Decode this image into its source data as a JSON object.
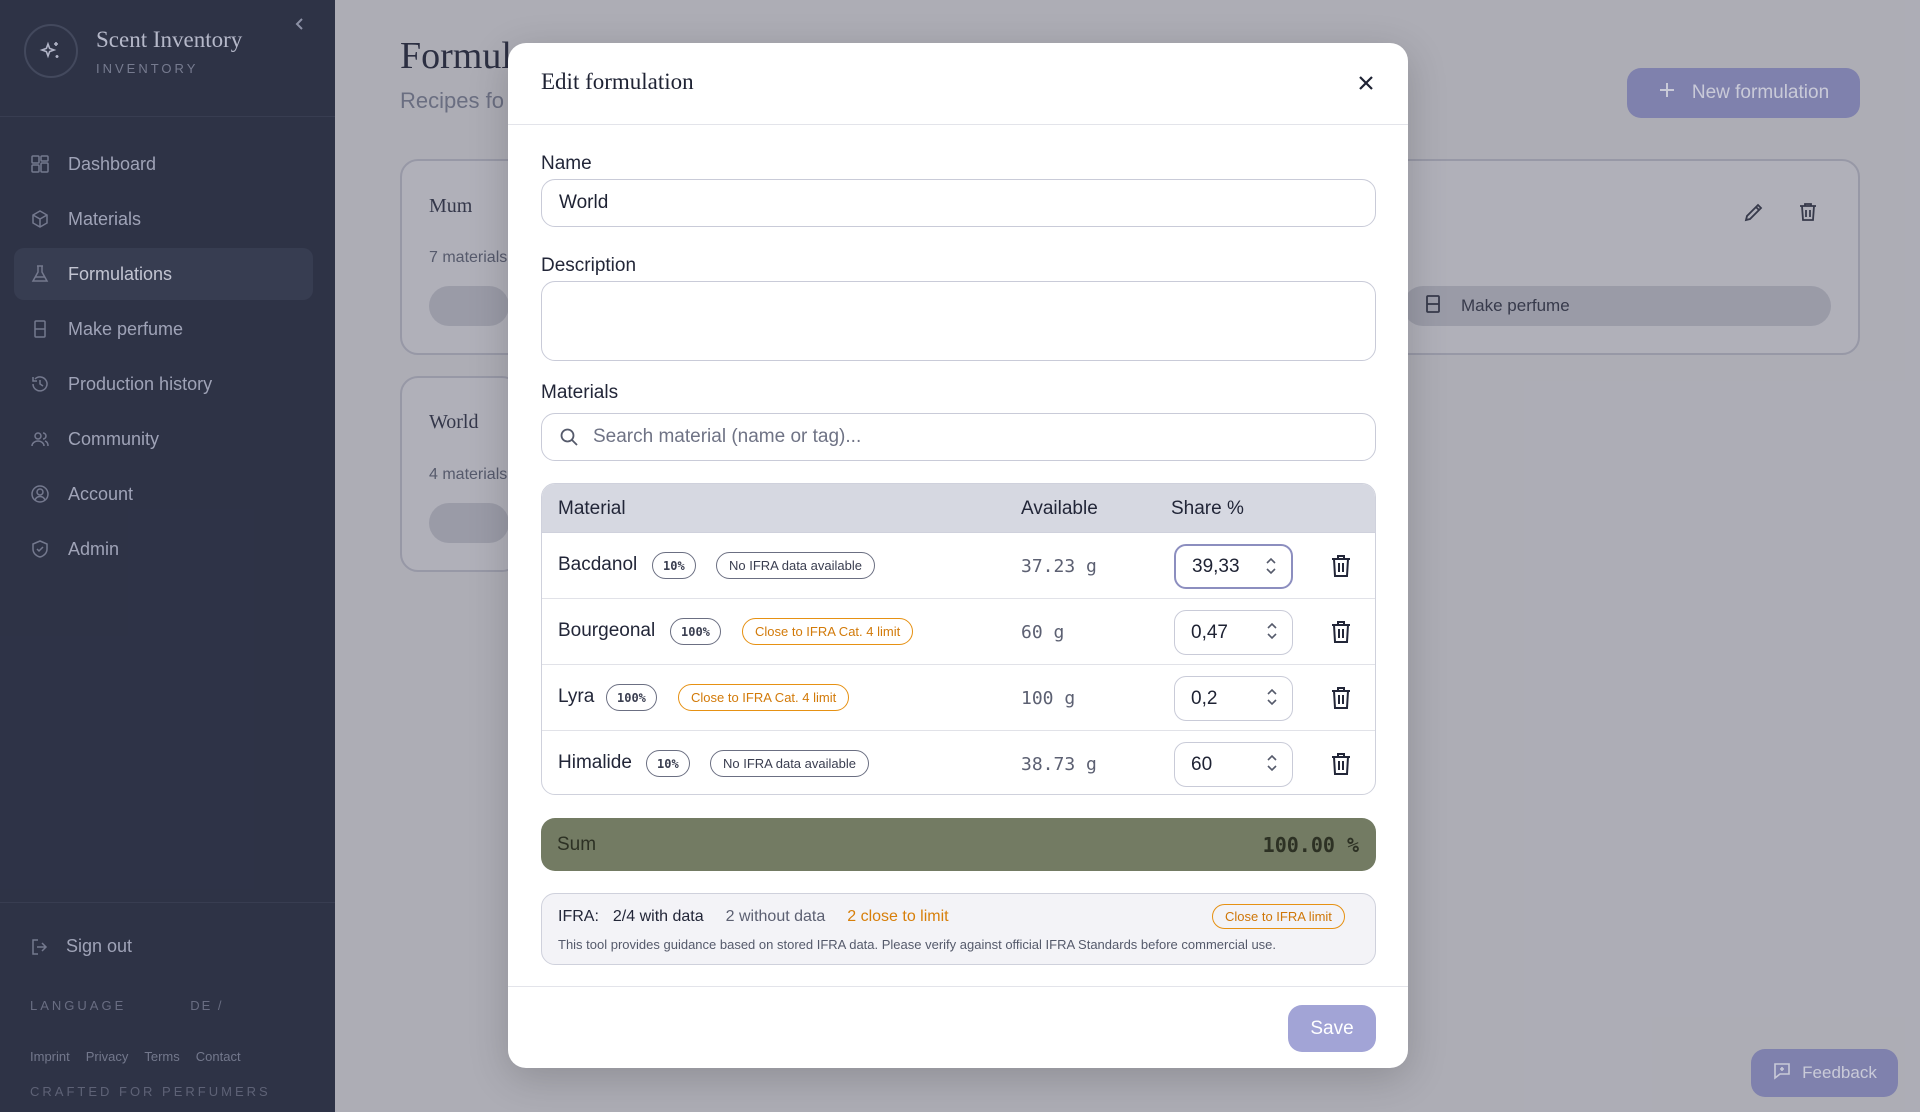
{
  "brand": {
    "title": "Scent Inventory",
    "subtitle": "INVENTORY",
    "logo_icon": "sparkle-icon"
  },
  "sidebar": {
    "items": [
      {
        "label": "Dashboard",
        "icon": "grid-icon"
      },
      {
        "label": "Materials",
        "icon": "box-icon"
      },
      {
        "label": "Formulations",
        "icon": "flask-icon",
        "active": true
      },
      {
        "label": "Make perfume",
        "icon": "bottle-icon"
      },
      {
        "label": "Production history",
        "icon": "history-icon"
      },
      {
        "label": "Community",
        "icon": "users-icon"
      },
      {
        "label": "Account",
        "icon": "user-circle-icon"
      },
      {
        "label": "Admin",
        "icon": "shield-icon"
      }
    ],
    "signout": "Sign out",
    "language_label": "LANGUAGE",
    "language_options": "DE  /",
    "footer_links": [
      "Imprint",
      "Privacy",
      "Terms",
      "Contact"
    ],
    "crafted": "CRAFTED FOR PERFUMERS"
  },
  "main": {
    "title": "Formul",
    "subtitle": "Recipes fo",
    "new_button": "New formulation",
    "cards": [
      {
        "title": "Mum",
        "meta": "7 materials"
      },
      {
        "title": "World",
        "meta": "4 materials"
      }
    ],
    "make_perfume": "Make perfume"
  },
  "modal": {
    "title": "Edit formulation",
    "name_label": "Name",
    "name_value": "World",
    "description_label": "Description",
    "description_value": "",
    "materials_label": "Materials",
    "search_placeholder": "Search material (name or tag)...",
    "table": {
      "headers": [
        "Material",
        "Available",
        "Share %"
      ],
      "rows": [
        {
          "name": "Bacdanol",
          "pct": "10%",
          "status": "No IFRA data available",
          "status_type": "neutral",
          "available": "37.23 g",
          "share": "39,33"
        },
        {
          "name": "Bourgeonal",
          "pct": "100%",
          "status": "Close to IFRA Cat. 4 limit",
          "status_type": "warn",
          "available": "60 g",
          "share": "0,47"
        },
        {
          "name": "Lyra",
          "pct": "100%",
          "status": "Close to IFRA Cat. 4 limit",
          "status_type": "warn",
          "available": "100 g",
          "share": "0,2"
        },
        {
          "name": "Himalide",
          "pct": "10%",
          "status": "No IFRA data available",
          "status_type": "neutral",
          "available": "38.73 g",
          "share": "60"
        }
      ]
    },
    "sum_label": "Sum",
    "sum_value": "100.00 %",
    "ifra": {
      "key": "IFRA:",
      "with_data": "2/4 with data",
      "without_data": "2 without data",
      "close_to_limit": "2 close to limit",
      "badge": "Close to IFRA limit",
      "note": "This tool provides guidance based on stored IFRA data. Please verify against official IFRA Standards before commercial use."
    },
    "save": "Save"
  },
  "feedback": "Feedback",
  "colors": {
    "sidebar": "#22283c",
    "accent": "#8a8cbf",
    "warn": "#e69113",
    "sum_bg": "#737b63"
  }
}
